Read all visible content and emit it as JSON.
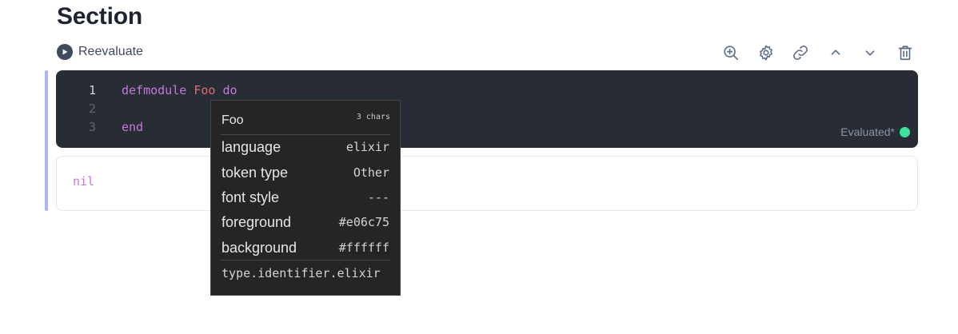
{
  "section": {
    "title": "Section"
  },
  "cell": {
    "reevaluate_label": "Reevaluate",
    "toolbar_icons": [
      "zoom-in-icon",
      "gear-icon",
      "link-icon",
      "chevron-up-icon",
      "chevron-down-icon",
      "trash-icon"
    ],
    "code_lines": [
      {
        "number": "1",
        "tokens": [
          {
            "text": "defmodule",
            "kind": "keyword"
          },
          {
            "text": " ",
            "kind": "plain"
          },
          {
            "text": "Foo",
            "kind": "module"
          },
          {
            "text": " ",
            "kind": "plain"
          },
          {
            "text": "do",
            "kind": "keyword"
          }
        ]
      },
      {
        "number": "2",
        "tokens": []
      },
      {
        "number": "3",
        "tokens": [
          {
            "text": "end",
            "kind": "keyword"
          }
        ]
      }
    ],
    "status": "Evaluated*",
    "output": "nil"
  },
  "tooltip": {
    "token": "Foo",
    "length": "3 chars",
    "rows": [
      {
        "key": "language",
        "value": "elixir"
      },
      {
        "key": "token type",
        "value": "Other"
      },
      {
        "key": "font style",
        "value": "---"
      },
      {
        "key": "foreground",
        "value": "#e06c75"
      },
      {
        "key": "background",
        "value": "#ffffff"
      }
    ],
    "scope": "type.identifier.elixir"
  },
  "colors": {
    "editor_bg": "#282c34",
    "keyword": "#c678dd",
    "module": "#e06c75",
    "status_dot": "#3ee2a0",
    "focus_bar": "#aab5f3"
  }
}
